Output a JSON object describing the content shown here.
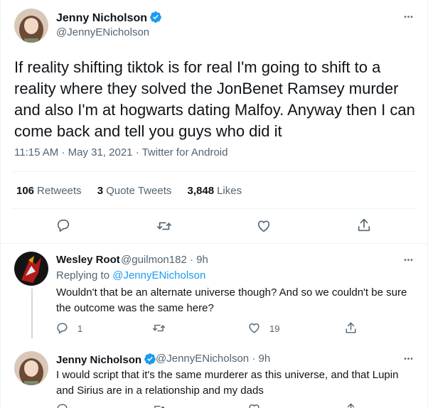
{
  "main_tweet": {
    "author_name": "Jenny Nicholson",
    "author_handle": "@JennyENicholson",
    "text": "If reality shifting tiktok is for real I'm going to shift to a reality where they solved the JonBenet Ramsey murder and also I'm at hogwarts dating Malfoy. Anyway then I can come back and tell you guys who did it",
    "time": "11:15 AM",
    "date": "May 31, 2021",
    "source": "Twitter for Android",
    "dot": "·",
    "stats": {
      "retweets_count": "106",
      "retweets_label": "Retweets",
      "quotes_count": "3",
      "quotes_label": "Quote Tweets",
      "likes_count": "3,848",
      "likes_label": "Likes"
    },
    "more_glyph": "•••"
  },
  "replies": [
    {
      "author_name": "Wesley Root",
      "author_handle": "@guilmon182",
      "time": "9h",
      "replying_to_label": "Replying to",
      "replying_to_handle": "@JennyENicholson",
      "text": "Wouldn't that be an alternate universe though? And so we couldn't be sure the outcome was the same here?",
      "reply_count": "1",
      "like_count": "19"
    },
    {
      "author_name": "Jenny Nicholson",
      "author_handle": "@JennyENicholson",
      "time": "9h",
      "text": "I would script that it's the same murderer as this universe, and that Lupin and Sirius are in a relationship and my dads"
    }
  ],
  "icons": {
    "verified": "verified-badge-icon",
    "reply": "reply-icon",
    "retweet": "retweet-icon",
    "like": "heart-icon",
    "share": "share-icon",
    "more": "more-icon"
  },
  "colors": {
    "accent": "#1d9bf0",
    "text": "#0f1419",
    "secondary": "#536471",
    "border": "#eff3f4"
  }
}
